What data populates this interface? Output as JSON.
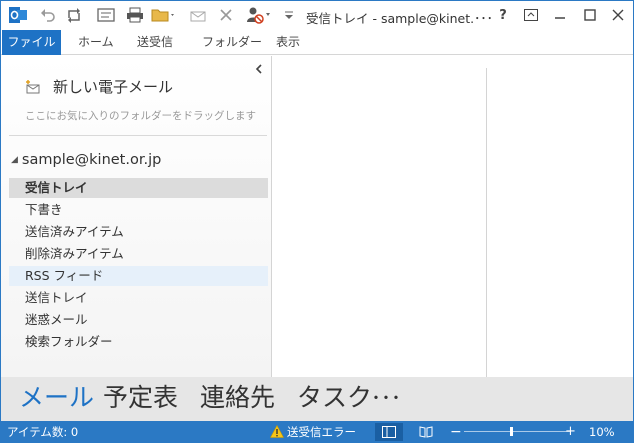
{
  "window": {
    "title": "受信トレイ - sample@kinet.･･･"
  },
  "quick_access": [
    "outlook-logo-icon",
    "undo-icon",
    "send-receive-icon",
    "sync-icon",
    "screen-icon",
    "print-icon",
    "folder-icon",
    "mail-icon",
    "delete-icon",
    "block-sender-icon",
    "customize-icon"
  ],
  "window_controls": {
    "help": "?"
  },
  "ribbon": {
    "tabs": [
      {
        "label": "ファイル"
      },
      {
        "label": "ホーム"
      },
      {
        "label": "送受信"
      },
      {
        "label": "フォルダー"
      },
      {
        "label": "表示"
      }
    ]
  },
  "folder_pane": {
    "new_mail": "新しい電子メール",
    "favorites_hint": "ここにお気に入りのフォルダーをドラッグします",
    "account": "sample@kinet.or.jp",
    "folders": [
      {
        "label": "受信トレイ",
        "state": "selected"
      },
      {
        "label": "下書き"
      },
      {
        "label": "送信済みアイテム"
      },
      {
        "label": "削除済みアイテム"
      },
      {
        "label": "RSS フィード",
        "state": "hover"
      },
      {
        "label": "送信トレイ"
      },
      {
        "label": "迷惑メール"
      },
      {
        "label": "検索フォルダー"
      }
    ]
  },
  "nav": {
    "items": [
      {
        "label": "メール",
        "active": true
      },
      {
        "label": "予定表"
      },
      {
        "label": "連絡先"
      },
      {
        "label": "タスク"
      },
      {
        "label": "･･･"
      }
    ]
  },
  "status": {
    "item_count": "アイテム数: 0",
    "error": "送受信エラー",
    "zoom": "10%",
    "zoom_minus": "−",
    "zoom_plus": "+"
  },
  "colors": {
    "accent": "#2b79c4",
    "file_tab": "#1e72c5",
    "nav_bg": "#e6e6e6"
  }
}
